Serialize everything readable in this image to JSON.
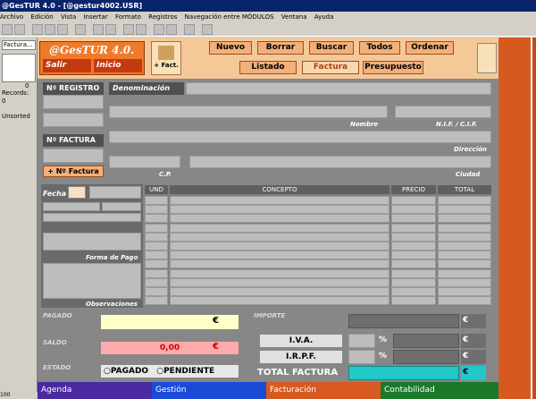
{
  "window": {
    "title": "@GesTUR 4.0 - [@gestur4002.USR]"
  },
  "menu": [
    "Archivo",
    "Edición",
    "Vista",
    "Insertar",
    "Formato",
    "Registros",
    "Navegación entre MÓDULOS",
    "Ventana",
    "Ayuda"
  ],
  "left": {
    "dropdown": "Factura...",
    "counter": "0",
    "records_label": "Records:",
    "records_value": "0",
    "sort": "Unsorted"
  },
  "header": {
    "app_name": "@GesTUR 4.0.",
    "exit_label": "Salir",
    "home_label": "Inicio",
    "fact_label": "+ Fact.",
    "buttons": [
      "Nuevo",
      "Borrar",
      "Buscar",
      "Todos",
      "Ordenar"
    ],
    "tabs": [
      "Listado",
      "Factura",
      "Presupuesto"
    ]
  },
  "form": {
    "registro_label": "Nº REGISTRO",
    "factura_label": "Nº FACTURA",
    "add_factura": "+ Nº Factura",
    "denominacion": "Denominación",
    "nombre": "Nombre",
    "nif": "N.I.F. / C.I.F.",
    "direccion": "Dirección",
    "cp": "C.P.",
    "ciudad": "Ciudad",
    "fecha": "Fecha",
    "forma_pago": "Forma de Pago",
    "observaciones": "Observaciones"
  },
  "grid": {
    "headers": [
      "UND",
      "CONCEPTO",
      "PRECIO",
      "TOTAL"
    ]
  },
  "footer": {
    "pagado": "PAGADO",
    "saldo": "SALDO",
    "estado": "ESTADO",
    "saldo_value": "0,00",
    "currency": "€",
    "opt_pagado": "PAGADO",
    "opt_pendiente": "PENDIENTE",
    "importe": "IMPORTE",
    "iva": "I.V.A.",
    "irpf": "I.R.P.F.",
    "total": "TOTAL FACTURA",
    "pct": "%"
  },
  "modules": [
    "Agenda",
    "Gestión",
    "Facturación",
    "Contabilidad"
  ],
  "status": {
    "zoom": "100"
  }
}
